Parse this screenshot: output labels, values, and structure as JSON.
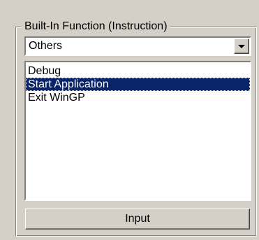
{
  "group": {
    "title": "Built-In Function (Instruction)"
  },
  "category_select": {
    "value": "Others"
  },
  "function_list": {
    "items": [
      {
        "label": "Debug",
        "selected": false
      },
      {
        "label": "Start Application",
        "selected": true
      },
      {
        "label": "Exit WinGP",
        "selected": false
      }
    ]
  },
  "actions": {
    "input_label": "Input"
  },
  "colors": {
    "panel": "#d4d0c8",
    "selection": "#0a246a",
    "selection_text": "#ffffff"
  }
}
